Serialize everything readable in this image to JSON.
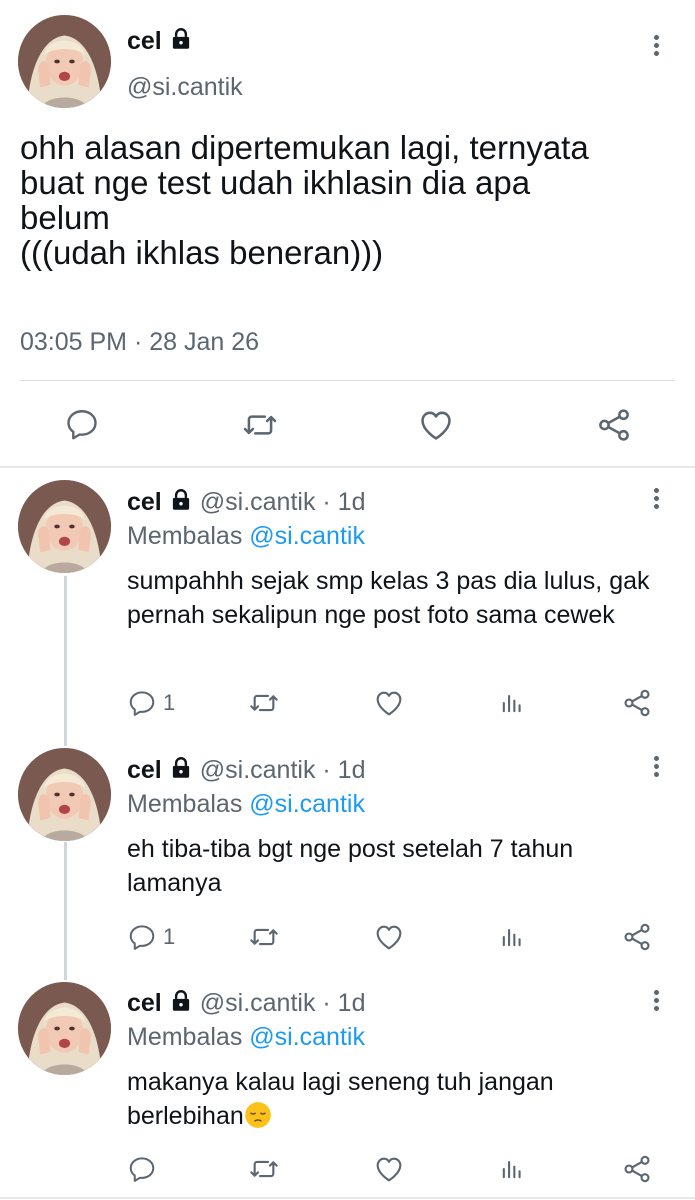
{
  "main_tweet": {
    "name": "cel",
    "handle": "@si.cantik",
    "text": "ohh alasan dipertemukan lagi, ternyata\nbuat nge test udah ikhlasin dia apa\nbelum\n(((udah ikhlas beneran)))",
    "timestamp": "03:05 PM · 28 Jan 26"
  },
  "replies": [
    {
      "name": "cel",
      "handle": "@si.cantik · 1d",
      "reply_prefix": "Membalas ",
      "reply_mention": "@si.cantik",
      "text": "sumpahhh sejak smp kelas 3 pas dia lulus, gak pernah sekalipun nge post foto sama cewek",
      "reply_count": "1"
    },
    {
      "name": "cel",
      "handle": "@si.cantik · 1d",
      "reply_prefix": "Membalas ",
      "reply_mention": "@si.cantik",
      "text": "eh tiba-tiba bgt nge post setelah 7 tahun lamanya",
      "reply_count": "1"
    },
    {
      "name": "cel",
      "handle": "@si.cantik · 1d",
      "reply_prefix": "Membalas ",
      "reply_mention": "@si.cantik",
      "text": "makanya kalau lagi seneng tuh jangan berlebihan",
      "emoji": "pensive-face",
      "reply_count": ""
    }
  ],
  "colors": {
    "text": "#0f1419",
    "secondary": "#5b6670",
    "link": "#1d9bf0",
    "divider": "#d8dde1"
  },
  "icons": [
    "reply-icon",
    "retweet-icon",
    "like-icon",
    "views-icon",
    "share-icon",
    "lock-icon",
    "more-icon"
  ]
}
